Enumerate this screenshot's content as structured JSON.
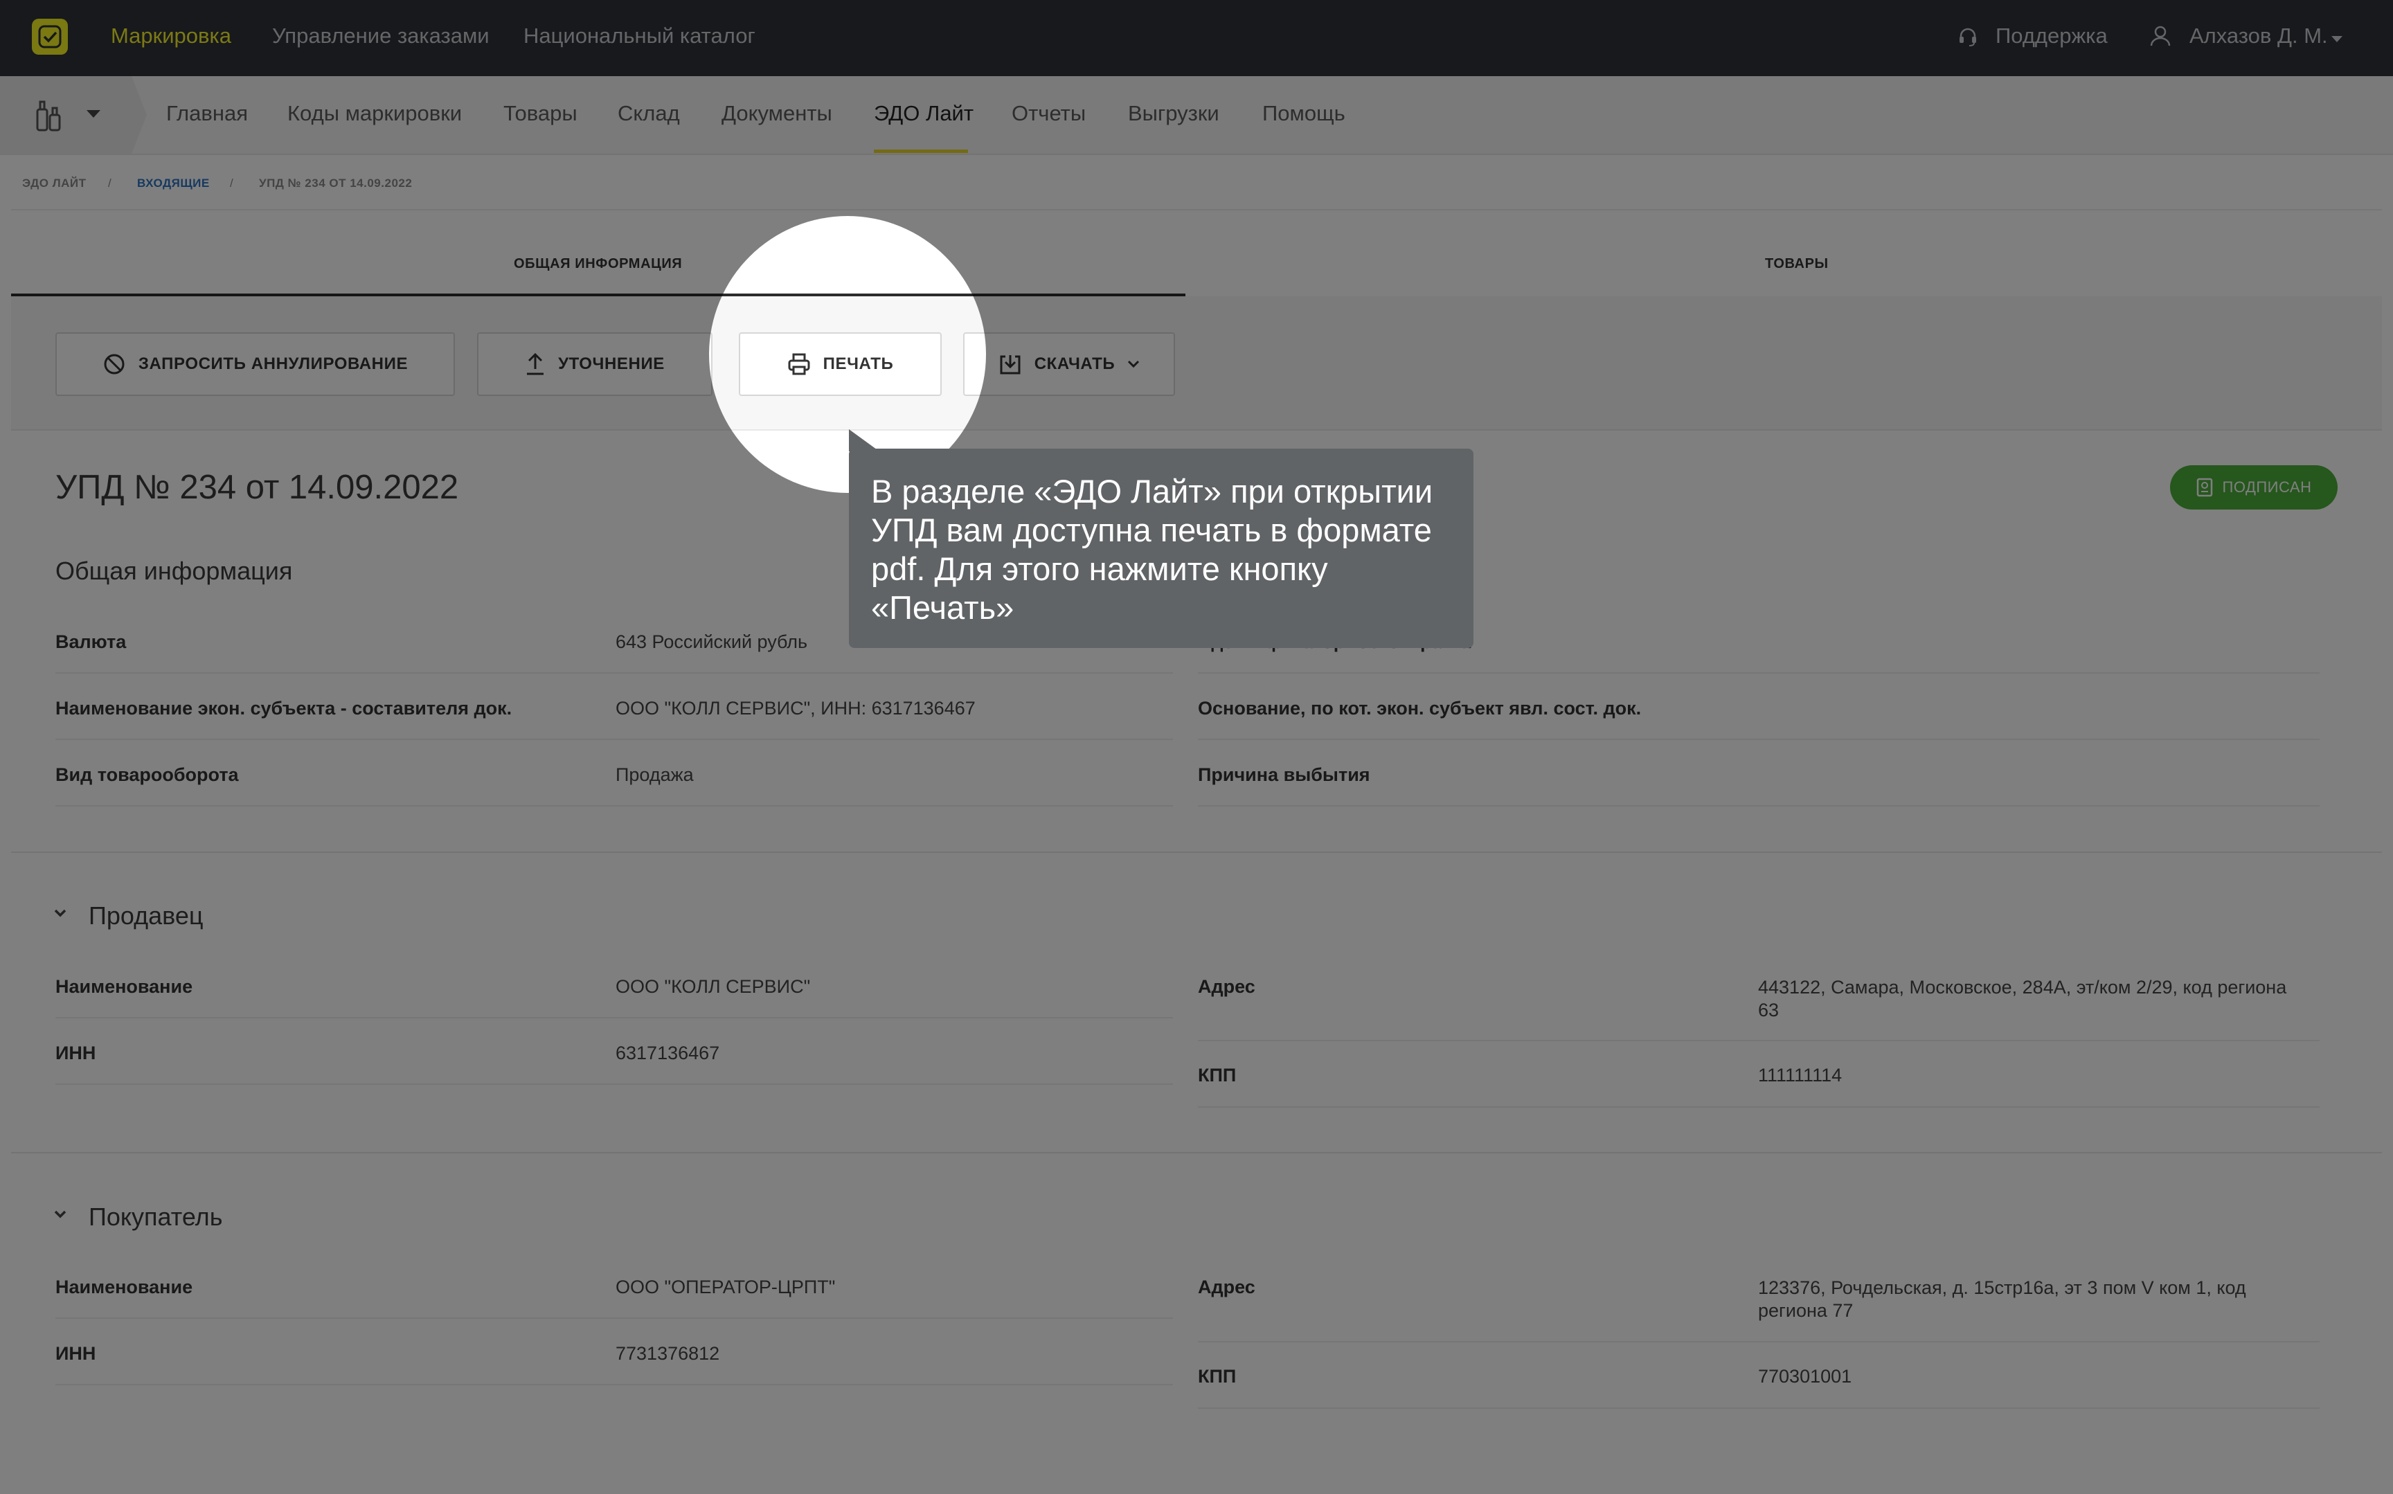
{
  "topbar": {
    "nav": [
      "Маркировка",
      "Управление заказами",
      "Национальный каталог"
    ],
    "support": "Поддержка",
    "user": "Алхазов Д. М."
  },
  "subnav": {
    "items": [
      "Главная",
      "Коды маркировки",
      "Товары",
      "Склад",
      "Документы",
      "ЭДО Лайт",
      "Отчеты",
      "Выгрузки",
      "Помощь"
    ],
    "active": "ЭДО Лайт"
  },
  "breadcrumb": [
    "ЭДО ЛАЙТ",
    "ВХОДЯЩИЕ",
    "УПД № 234 ОТ 14.09.2022"
  ],
  "tabs": [
    "ОБЩАЯ ИНФОРМАЦИЯ",
    "ТОВАРЫ"
  ],
  "toolbar": {
    "cancel": "ЗАПРОСИТЬ АННУЛИРОВАНИЕ",
    "clarify": "УТОЧНЕНИЕ",
    "print": "ПЕЧАТЬ",
    "download": "СКАЧАТЬ"
  },
  "document": {
    "title": "УПД № 234 от 14.09.2022",
    "status": "ПОДПИСАН"
  },
  "general": {
    "title": "Общая информация",
    "left": [
      {
        "label": "Валюта",
        "value": "643   Российский рубль"
      },
      {
        "label": "Наименование экон. субъекта - составителя док.",
        "value": "ООО \"КОЛЛ СЕРВИС\", ИНН: 6317136467"
      },
      {
        "label": "Вид товарооборота",
        "value": "Продажа"
      }
    ],
    "right": [
      {
        "label": "Идентификатор госконтракта",
        "value": ""
      },
      {
        "label": "Основание, по кот. экон. субъект явл. сост. док.",
        "value": ""
      },
      {
        "label": "Причина выбытия",
        "value": ""
      }
    ]
  },
  "seller": {
    "title": "Продавец",
    "name_label": "Наименование",
    "name": "ООО \"КОЛЛ СЕРВИС\"",
    "inn_label": "ИНН",
    "inn": "6317136467",
    "address_label": "Адрес",
    "address": "443122, Самара, Московское, 284А, эт/ком 2/29, код региона 63",
    "kpp_label": "КПП",
    "kpp": "111111114"
  },
  "buyer": {
    "title": "Покупатель",
    "name_label": "Наименование",
    "name": "ООО \"ОПЕРАТОР-ЦРПТ\"",
    "inn_label": "ИНН",
    "inn": "7731376812",
    "address_label": "Адрес",
    "address": "123376, Рочдельская, д. 15стр16а, эт 3 пом V ком 1, код региона 77",
    "kpp_label": "КПП",
    "kpp": "770301001"
  },
  "tooltip": {
    "text": "В разделе «ЭДО Лайт» при открытии\nУПД вам доступна печать в формате\npdf. Для этого нажмите кнопку\n«Печать»"
  },
  "colors": {
    "topbar": "#2f3338",
    "accent_yellow": "#f6f22a",
    "link_blue": "#2f73c0",
    "status_green": "#4caf3a",
    "overlay_dim": "rgba(0,0,0,0.5)"
  }
}
